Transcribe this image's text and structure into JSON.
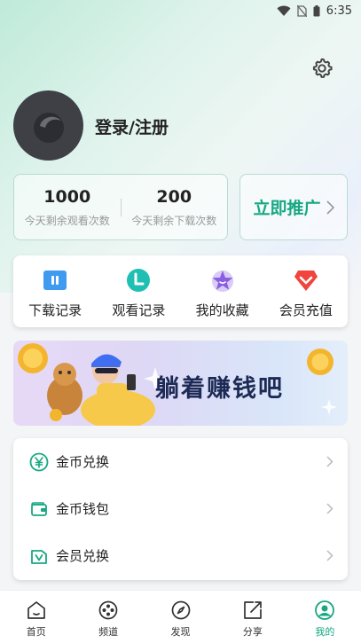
{
  "status_bar": {
    "time": "6:35"
  },
  "profile": {
    "login_label": "登录/注册"
  },
  "stats": [
    {
      "value": "1000",
      "label": "今天剩余观看次数"
    },
    {
      "value": "200",
      "label": "今天剩余下载次数"
    }
  ],
  "promote": {
    "label": "立即推广"
  },
  "quick_actions": [
    {
      "label": "下载记录",
      "icon": "download-record-icon"
    },
    {
      "label": "观看记录",
      "icon": "watch-history-icon"
    },
    {
      "label": "我的收藏",
      "icon": "star-icon"
    },
    {
      "label": "会员充值",
      "icon": "diamond-icon"
    }
  ],
  "banner": {
    "text": "躺着赚钱吧"
  },
  "menu": [
    {
      "label": "金币兑换",
      "icon": "yen-coin-icon"
    },
    {
      "label": "金币钱包",
      "icon": "wallet-icon"
    },
    {
      "label": "会员兑换",
      "icon": "vip-icon"
    }
  ],
  "tabs": [
    {
      "label": "首页",
      "icon": "home-icon",
      "active": false
    },
    {
      "label": "频道",
      "icon": "film-reel-icon",
      "active": false
    },
    {
      "label": "发现",
      "icon": "compass-icon",
      "active": false
    },
    {
      "label": "分享",
      "icon": "share-icon",
      "active": false
    },
    {
      "label": "我的",
      "icon": "user-icon",
      "active": true
    }
  ],
  "colors": {
    "accent": "#17a883",
    "dark_text": "#222222",
    "muted_text": "#999999"
  }
}
